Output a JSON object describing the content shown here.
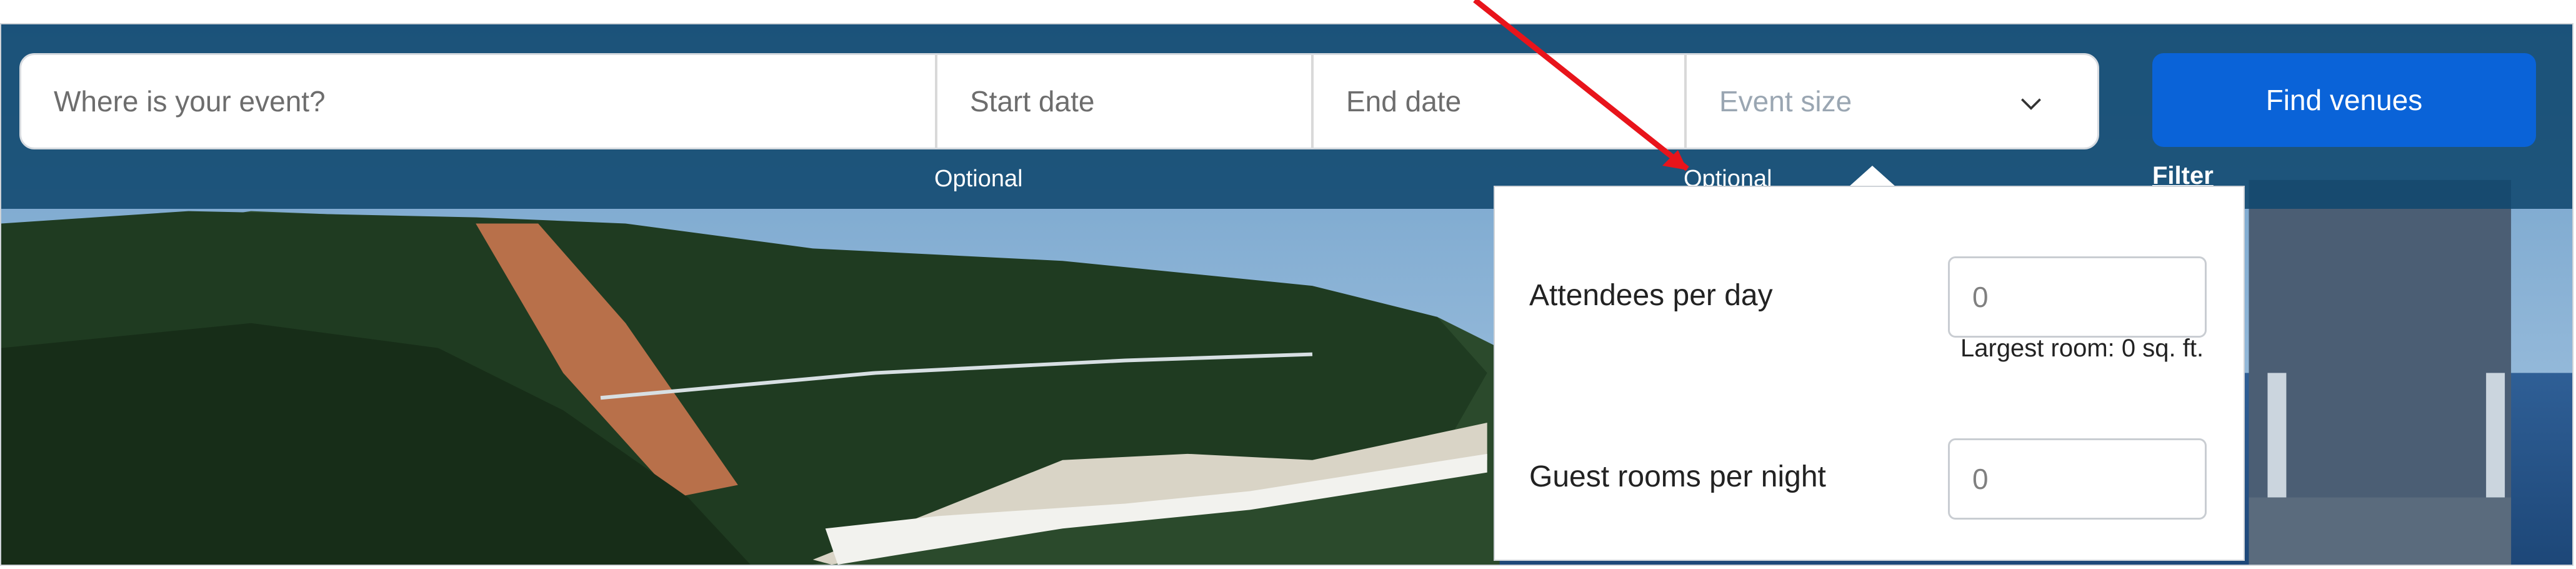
{
  "search": {
    "location_placeholder": "Where is your event?",
    "start_date_placeholder": "Start date",
    "end_date_placeholder": "End date",
    "event_size_placeholder": "Event size",
    "find_button_label": "Find venues",
    "start_date_hint": "Optional",
    "event_size_hint": "Optional",
    "filter_label": "Filter"
  },
  "event_size_popover": {
    "attendees_label": "Attendees per day",
    "attendees_value": "0",
    "largest_room_note": "Largest room: 0 sq. ft.",
    "guest_rooms_label": "Guest rooms per night",
    "guest_rooms_value": "0"
  },
  "icons": {
    "event_size_dropdown": "chevron-down-icon"
  },
  "colors": {
    "search_strip": "#10486e",
    "find_button": "#0a63d8",
    "annotation_arrow": "#e8141b"
  }
}
